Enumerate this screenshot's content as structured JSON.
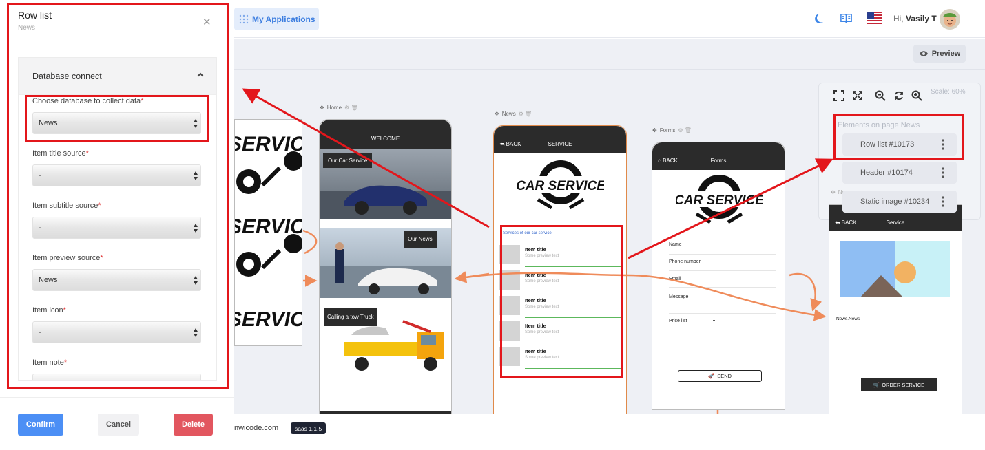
{
  "topbar": {
    "my_apps_label": "My Applications",
    "greeting": "Hi,",
    "user_name": "Vasily T"
  },
  "toolbar": {
    "preview_label": "Preview",
    "scale_label": "Scale: 60%",
    "elements_title": "Elements on page News",
    "elements": [
      {
        "label": "Row list #10173"
      },
      {
        "label": "Header #10174"
      },
      {
        "label": "Static image #10234"
      }
    ],
    "under_label": "Ne"
  },
  "pages": {
    "home": {
      "name": "Home",
      "header": "WELCOME",
      "tiles": [
        "Our Car Service",
        "Our News",
        "Calling a tow Truck"
      ]
    },
    "news": {
      "name": "News",
      "back": "BACK",
      "title": "SERVICE",
      "logo_text": "CAR SERVICE",
      "list_heading": "Services of our car service",
      "rows": [
        {
          "title": "Item title",
          "subtitle": "Some preview text"
        },
        {
          "title": "Item title",
          "subtitle": "Some preview text"
        },
        {
          "title": "Item title",
          "subtitle": "Some preview text"
        },
        {
          "title": "Item title",
          "subtitle": "Some preview text"
        },
        {
          "title": "Item title",
          "subtitle": "Some preview text"
        }
      ]
    },
    "forms": {
      "name": "Forms",
      "back": "BACK",
      "title": "Forms",
      "logo_text": "CAR SERVICE",
      "fields": [
        "Name",
        "Phone number",
        "Email",
        "Message",
        "Price list"
      ],
      "send_label": "SEND"
    },
    "service": {
      "back": "BACK",
      "title": "Service",
      "caption": "News.News",
      "order_label": "ORDER SERVICE"
    },
    "bg_logo_text": "SERVICE"
  },
  "panel": {
    "title": "Row list",
    "subtitle": "News",
    "section_title": "Database connect",
    "fields": [
      {
        "label": "Choose database to collect data",
        "value": "News"
      },
      {
        "label": "Item title source",
        "value": "-"
      },
      {
        "label": "Item subtitle source",
        "value": "-"
      },
      {
        "label": "Item preview source",
        "value": "News"
      },
      {
        "label": "Item icon",
        "value": "-"
      },
      {
        "label": "Item note",
        "value": ""
      }
    ],
    "required_mark": "*",
    "confirm_label": "Confirm",
    "cancel_label": "Cancel",
    "delete_label": "Delete",
    "colors": {
      "confirm": "#4c8ff5",
      "delete": "#e2565f",
      "highlight": "#e3161b",
      "arrow": "#ef8b5a"
    }
  },
  "footer": {
    "domain": "nwicode.com",
    "version": "saas 1.1.5"
  }
}
